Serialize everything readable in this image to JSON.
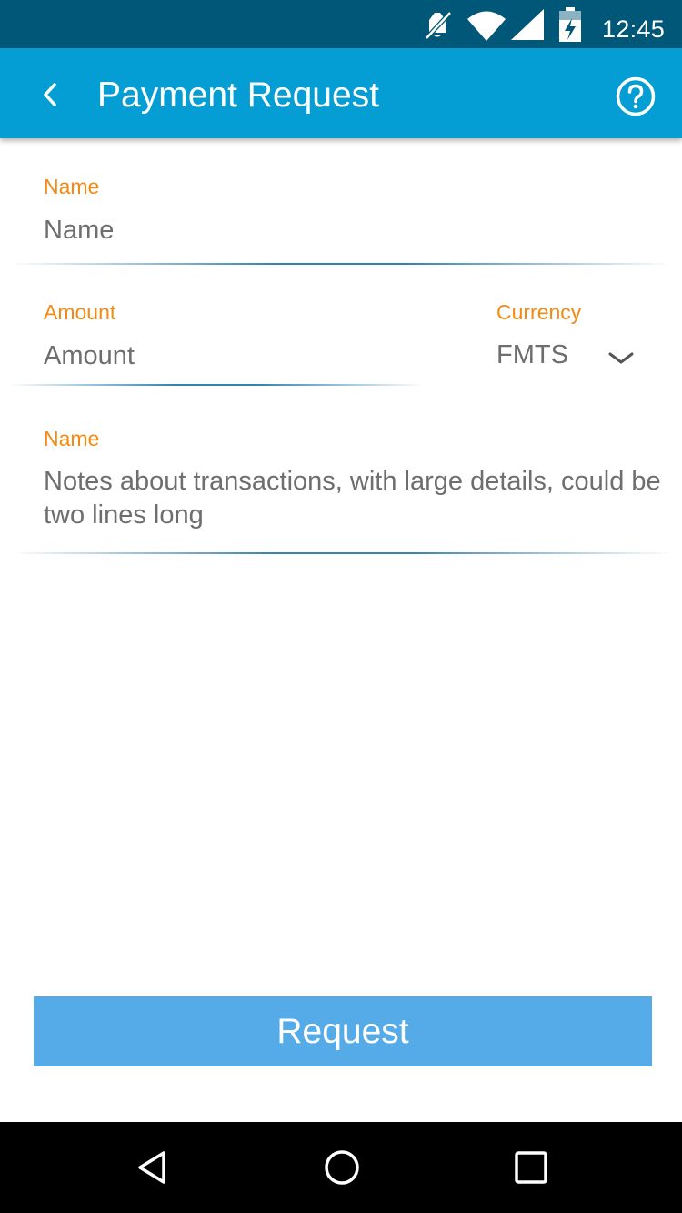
{
  "status_bar": {
    "time": "12:45",
    "icons": [
      "mute-icon",
      "wifi-icon",
      "signal-icon",
      "battery-charging-icon"
    ]
  },
  "app_bar": {
    "title": "Payment Request",
    "back_icon": "chevron-left-icon",
    "help_icon": "help-circle-icon"
  },
  "form": {
    "name": {
      "label": "Name",
      "placeholder": "Name",
      "value": ""
    },
    "amount": {
      "label": "Amount",
      "placeholder": "Amount",
      "value": ""
    },
    "currency": {
      "label": "Currency",
      "selected": "FMTS",
      "icon": "chevron-down-icon"
    },
    "notes": {
      "label": "Name",
      "placeholder": "Notes about transactions, with large details, could be two lines long",
      "value": ""
    }
  },
  "actions": {
    "request_label": "Request"
  },
  "nav_bar": {
    "icons": [
      "nav-back-icon",
      "nav-home-icon",
      "nav-recents-icon"
    ]
  },
  "colors": {
    "status_bar": "#005777",
    "app_bar": "#049ed4",
    "label_accent": "#f28a13",
    "button": "#55abe8",
    "input_text": "#6e6e6e"
  }
}
